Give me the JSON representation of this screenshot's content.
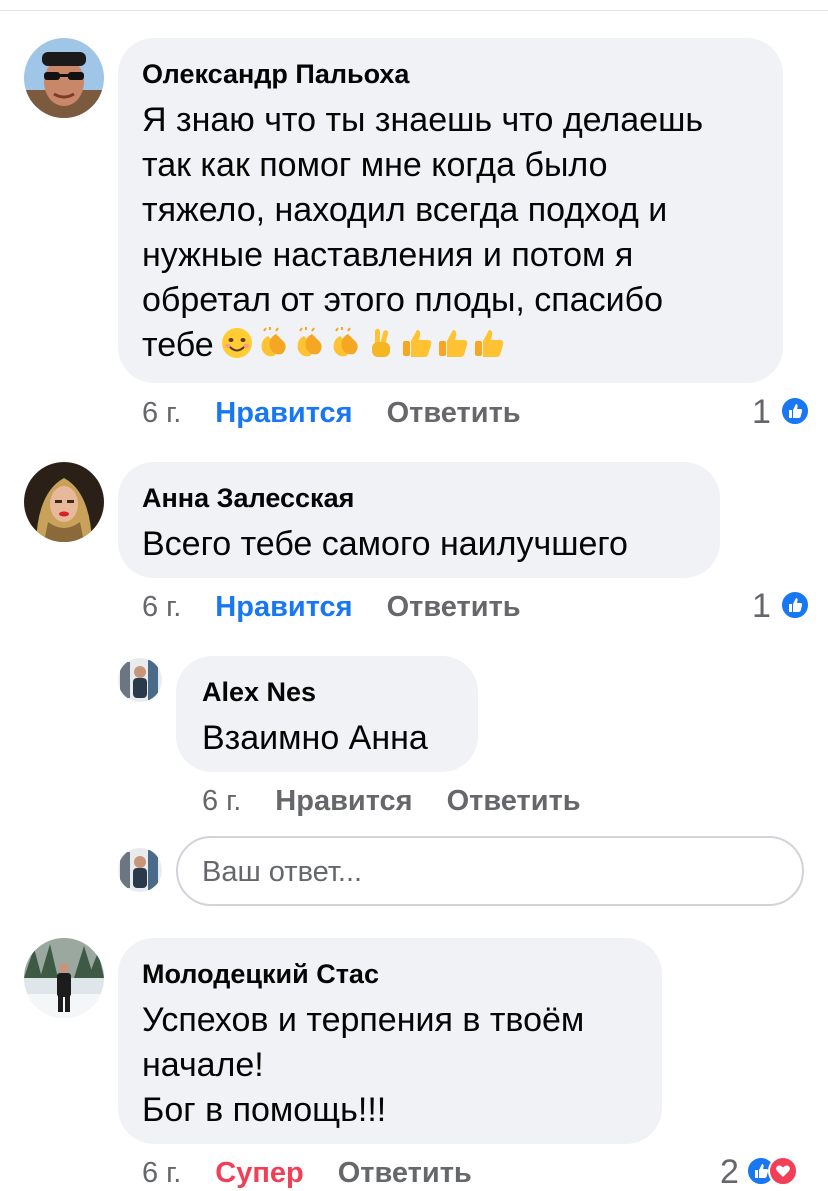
{
  "comments": [
    {
      "author": "Олександр Пальоха",
      "text_lines": [
        "Я знаю что ты знаешь что делаешь",
        "так как помог мне когда было",
        "тяжело,  находил всегда подход и",
        "нужные наставления и потом я",
        "обретал от этого плоды, спасибо",
        "тебе"
      ],
      "emojis": [
        "smiling-face",
        "clapping-hands",
        "clapping-hands",
        "clapping-hands",
        "victory-hand",
        "thumbs-up",
        "thumbs-up",
        "thumbs-up"
      ],
      "time": "6 г.",
      "like_label": "Нравится",
      "reply_label": "Ответить",
      "reaction_count": "1",
      "reactions": [
        "like-icon"
      ]
    },
    {
      "author": "Анна Залесская",
      "text_lines": [
        "Всего тебе самого наилучшего"
      ],
      "time": "6 г.",
      "like_label": "Нравится",
      "reply_label": "Ответить",
      "reaction_count": "1",
      "reactions": [
        "like-icon"
      ]
    },
    {
      "author": "Молодецкий Стас",
      "text_lines": [
        "Успехов и терпения в твоём",
        "начале!",
        "Бог в помощь!!!"
      ],
      "time": "6 г.",
      "like_label": "Супер",
      "reply_label": "Ответить",
      "reaction_count": "2",
      "reactions": [
        "like-icon",
        "love-icon"
      ]
    }
  ],
  "reply": {
    "author": "Alex Nes",
    "text": "Взаимно Анна",
    "time": "6 г.",
    "like_label": "Нравится",
    "reply_label": "Ответить"
  },
  "reply_input": {
    "placeholder": "Ваш ответ..."
  },
  "colors": {
    "bubble": "#f0f2f5",
    "liked": "#1877f2",
    "super": "#f33e58",
    "meta": "#65676b"
  }
}
